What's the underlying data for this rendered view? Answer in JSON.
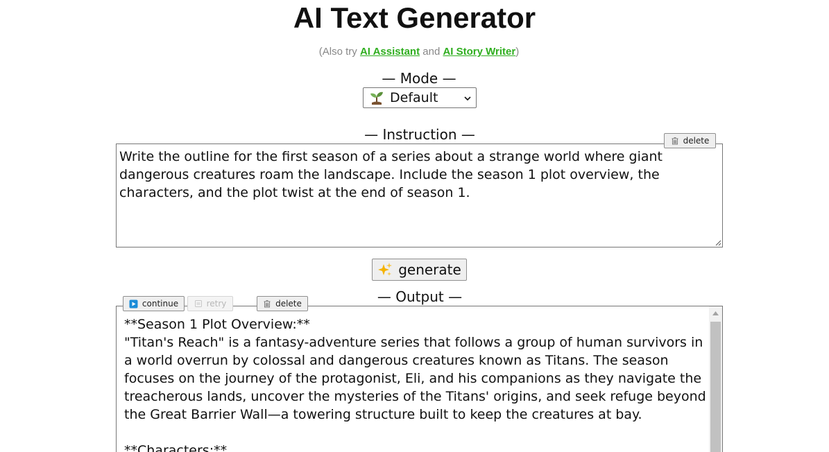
{
  "header": {
    "title": "AI Text Generator",
    "also_prefix": "(Also try ",
    "link_assistant": "AI Assistant",
    "and_text": " and ",
    "link_story": "AI Story Writer",
    "also_suffix": ")"
  },
  "mode": {
    "label": "— Mode —",
    "selected": "Default",
    "icon": "seedling-icon"
  },
  "instruction": {
    "label": "— Instruction —",
    "delete_label": "delete",
    "text": "Write the outline for the first season of a series about a strange world where giant dangerous creatures roam the landscape. Include the season 1 plot overview, the characters, and the plot twist at the end of season 1."
  },
  "generate": {
    "label": "generate",
    "icon": "sparkles-icon"
  },
  "output": {
    "label": "— Output —",
    "continue_label": "continue",
    "retry_label": "retry",
    "delete_label": "delete",
    "text": "**Season 1 Plot Overview:**\n\"Titan's Reach\" is a fantasy-adventure series that follows a group of human survivors in a world overrun by colossal and dangerous creatures known as Titans. The season focuses on the journey of the protagonist, Eli, and his companions as they navigate the treacherous lands, uncover the mysteries of the Titans' origins, and seek refuge beyond the Great Barrier Wall—a towering structure built to keep the creatures at bay.\n\n**Characters:**"
  },
  "colors": {
    "link": "#2fae1f",
    "continue_icon": "#1a8cd8"
  }
}
